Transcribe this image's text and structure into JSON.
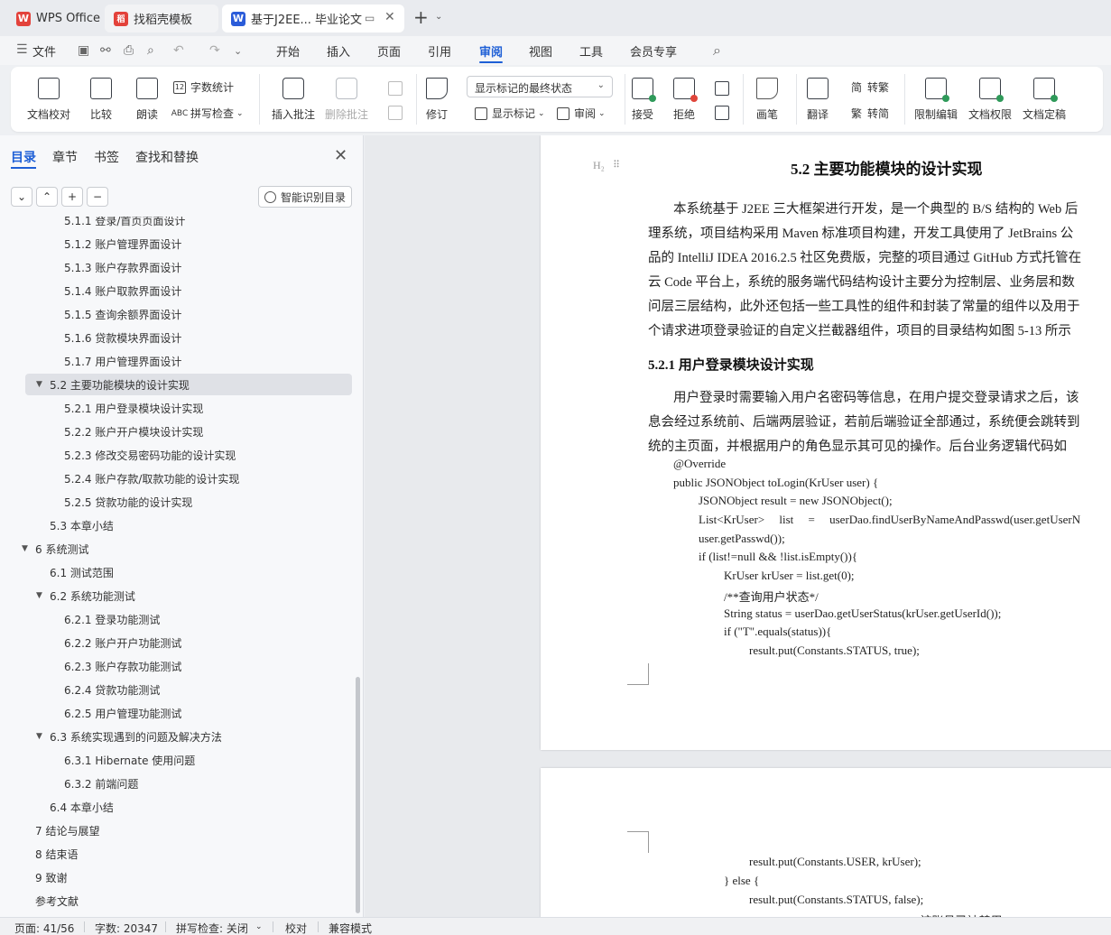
{
  "tabs": [
    {
      "label": "WPS Office",
      "logo": "W"
    },
    {
      "label": "找稻壳模板",
      "logo": "稻"
    },
    {
      "label": "基于J2EE... 毕业论文",
      "logo": "W"
    }
  ],
  "menu": {
    "file": "文件",
    "items": [
      "开始",
      "插入",
      "页面",
      "引用",
      "审阅",
      "视图",
      "工具",
      "会员专享"
    ],
    "active": "审阅"
  },
  "ribbon": {
    "proofread": "文档校对",
    "compare": "比较",
    "read_aloud": "朗读",
    "word_count": "字数统计",
    "spell_check": "拼写检查",
    "insert_comment": "插入批注",
    "delete_comment": "删除批注",
    "revise": "修订",
    "markup_state": "显示标记的最终状态",
    "show_markup": "显示标记",
    "review": "审阅",
    "accept": "接受",
    "reject": "拒绝",
    "pen": "画笔",
    "translate": "翻译",
    "to_traditional": "转繁",
    "to_simplified": "转简",
    "restrict_edit": "限制编辑",
    "doc_permission": "文档权限",
    "finalize": "文档定稿"
  },
  "sidebar": {
    "tabs": [
      "目录",
      "章节",
      "书签",
      "查找和替换"
    ],
    "buttons": [
      "⌄",
      "⌃",
      "+",
      "−"
    ],
    "smart_toc": "智能识别目录",
    "toc": [
      {
        "text": "5.1.1  登录/首页页面设计",
        "level": 3
      },
      {
        "text": "5.1.2  账户管理界面设计",
        "level": 3
      },
      {
        "text": "5.1.3  账户存款界面设计",
        "level": 3
      },
      {
        "text": "5.1.4  账户取款界面设计",
        "level": 3
      },
      {
        "text": "5.1.5  查询余额界面设计",
        "level": 3
      },
      {
        "text": "5.1.6  贷款模块界面设计",
        "level": 3
      },
      {
        "text": "5.1.7  用户管理界面设计",
        "level": 3
      },
      {
        "text": "5.2  主要功能模块的设计实现",
        "level": 2,
        "expanded": true,
        "selected": true
      },
      {
        "text": "5.2.1  用户登录模块设计实现",
        "level": 3
      },
      {
        "text": "5.2.2  账户开户模块设计实现",
        "level": 3
      },
      {
        "text": "5.2.3  修改交易密码功能的设计实现",
        "level": 3
      },
      {
        "text": "5.2.4  账户存款/取款功能的设计实现",
        "level": 3
      },
      {
        "text": "5.2.5  贷款功能的设计实现",
        "level": 3
      },
      {
        "text": "5.3  本章小结",
        "level": 2
      },
      {
        "text": "6  系统测试",
        "level": 1,
        "expanded": true
      },
      {
        "text": "6.1  测试范围",
        "level": 2
      },
      {
        "text": "6.2  系统功能测试",
        "level": 2,
        "expanded": true
      },
      {
        "text": "6.2.1  登录功能测试",
        "level": 3
      },
      {
        "text": "6.2.2  账户开户功能测试",
        "level": 3
      },
      {
        "text": "6.2.3  账户存款功能测试",
        "level": 3
      },
      {
        "text": "6.2.4  贷款功能测试",
        "level": 3
      },
      {
        "text": "6.2.5  用户管理功能测试",
        "level": 3
      },
      {
        "text": "6.3 系统实现遇到的问题及解决方法",
        "level": 2,
        "expanded": true
      },
      {
        "text": "6.3.1 Hibernate 使用问题",
        "level": 3
      },
      {
        "text": "6.3.2  前端问题",
        "level": 3
      },
      {
        "text": "6.4  本章小结",
        "level": 2
      },
      {
        "text": "7  结论与展望",
        "level": 1
      },
      {
        "text": "8  结束语",
        "level": 1
      },
      {
        "text": "9  致谢",
        "level": 1
      },
      {
        "text": "参考文献",
        "level": 1
      }
    ]
  },
  "document": {
    "heading_mark": "H₂",
    "h2": "5.2  主要功能模块的设计实现",
    "para1": [
      "本系统基于 J2EE 三大框架进行开发，是一个典型的 B/S 结构的 Web 后",
      "理系统，项目结构采用 Maven 标准项目构建，开发工具使用了 JetBrains 公",
      "品的 IntelliJ IDEA 2016.2.5 社区免费版，完整的项目通过 GitHub 方式托管在",
      "云 Code 平台上，系统的服务端代码结构设计主要分为控制层、业务层和数",
      "问层三层结构，此外还包括一些工具性的组件和封装了常量的组件以及用于",
      "个请求进项登录验证的自定义拦截器组件，项目的目录结构如图 5-13 所示"
    ],
    "h3": "5.2.1  用户登录模块设计实现",
    "para2": [
      "用户登录时需要输入用户名密码等信息，在用户提交登录请求之后，该",
      "息会经过系统前、后端两层验证，若前后端验证全部通过，系统便会跳转到",
      "统的主页面，并根据用户的角色显示其可见的操作。后台业务逻辑代码如"
    ],
    "code1": [
      "@Override",
      "public JSONObject toLogin(KrUser user) {",
      "JSONObject result = new JSONObject();",
      "List<KrUser>     list     =     userDao.findUserByNameAndPasswd(user.getUserN",
      "user.getPasswd());",
      "if (list!=null && !list.isEmpty()){",
      "KrUser krUser = list.get(0);",
      "/**查询用户状态*/",
      "String status = userDao.getUserStatus(krUser.getUserId());",
      "if (\"T\".equals(status)){",
      "result.put(Constants.STATUS, true);"
    ],
    "code2": [
      "result.put(Constants.USER, krUser);",
      "} else {",
      "result.put(Constants.STATUS, false);",
      "    resul.put(Constants.MESSAGE, \"该账号已被禁用\");"
    ]
  },
  "status": {
    "page": "页面: 41/56",
    "words": "字数: 20347",
    "spell": "拼写检查: 关闭",
    "proofread": "校对",
    "compat": "兼容模式"
  },
  "colors": {
    "accent": "#1e5fd6",
    "wps_red": "#e3423b",
    "word_blue": "#2b5cd9"
  }
}
